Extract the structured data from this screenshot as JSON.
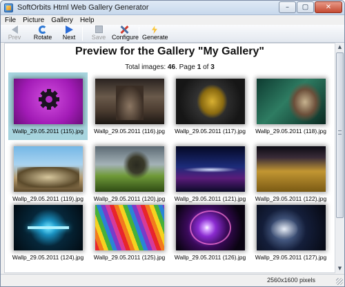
{
  "window": {
    "title": "SoftOrbits Html Web Gallery Generator"
  },
  "titlebar_buttons": {
    "minimize": "–",
    "maximize": "▢",
    "close": "✕"
  },
  "menu": [
    "File",
    "Picture",
    "Gallery",
    "Help"
  ],
  "toolbar": {
    "prev": "Prev",
    "rotate": "Rotate",
    "next": "Next",
    "save": "Save",
    "configure": "Configure",
    "generate": "Generate"
  },
  "gallery": {
    "title": "Preview for the Gallery \"My Gallery\"",
    "total_label": "Total images:",
    "total": "46",
    "page_label": ". Page",
    "page": "1",
    "of_label": "of",
    "pages": "3"
  },
  "thumbnails": [
    "Wallp_29.05.2011 (115).jpg",
    "Wallp_29.05.2011 (116).jpg",
    "Wallp_29.05.2011 (117).jpg",
    "Wallp_29.05.2011 (118).jpg",
    "Wallp_29.05.2011 (119).jpg",
    "Wallp_29.05.2011 (120).jpg",
    "Wallp_29.05.2011 (121).jpg",
    "Wallp_29.05.2011 (122).jpg",
    "Wallp_29.05.2011 (124).jpg",
    "Wallp_29.05.2011 (125).jpg",
    "Wallp_29.05.2011 (126).jpg",
    "Wallp_29.05.2011 (127).jpg"
  ],
  "scrollbar": {
    "up": "▲",
    "down": "▼"
  },
  "status": {
    "dimensions": "2560x1600 pixels"
  }
}
